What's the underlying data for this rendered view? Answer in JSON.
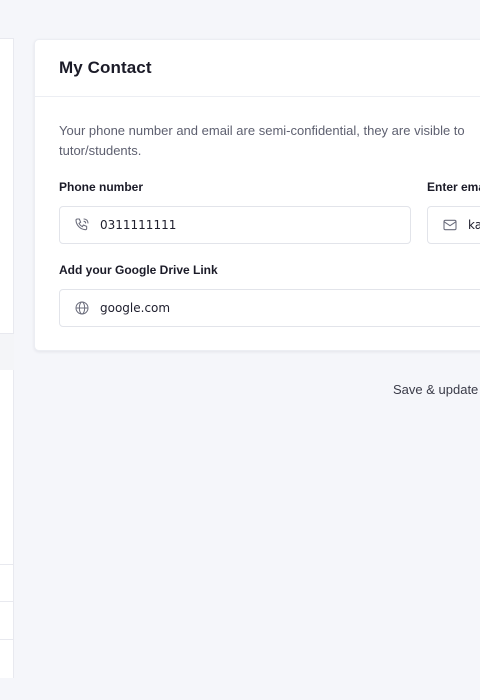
{
  "card": {
    "title": "My Contact",
    "description": "Your phone number and email are semi-confidential, they are visible to tutor/students.",
    "phone": {
      "label": "Phone number",
      "value": "0311111111"
    },
    "email": {
      "label": "Enter email",
      "value": "ka"
    },
    "drive": {
      "label": "Add your Google Drive Link",
      "value": "google.com"
    }
  },
  "actions": {
    "save_label": "Save & update"
  },
  "icons": {
    "phone": "phone-icon",
    "email": "mail-icon",
    "drive": "globe-icon"
  }
}
